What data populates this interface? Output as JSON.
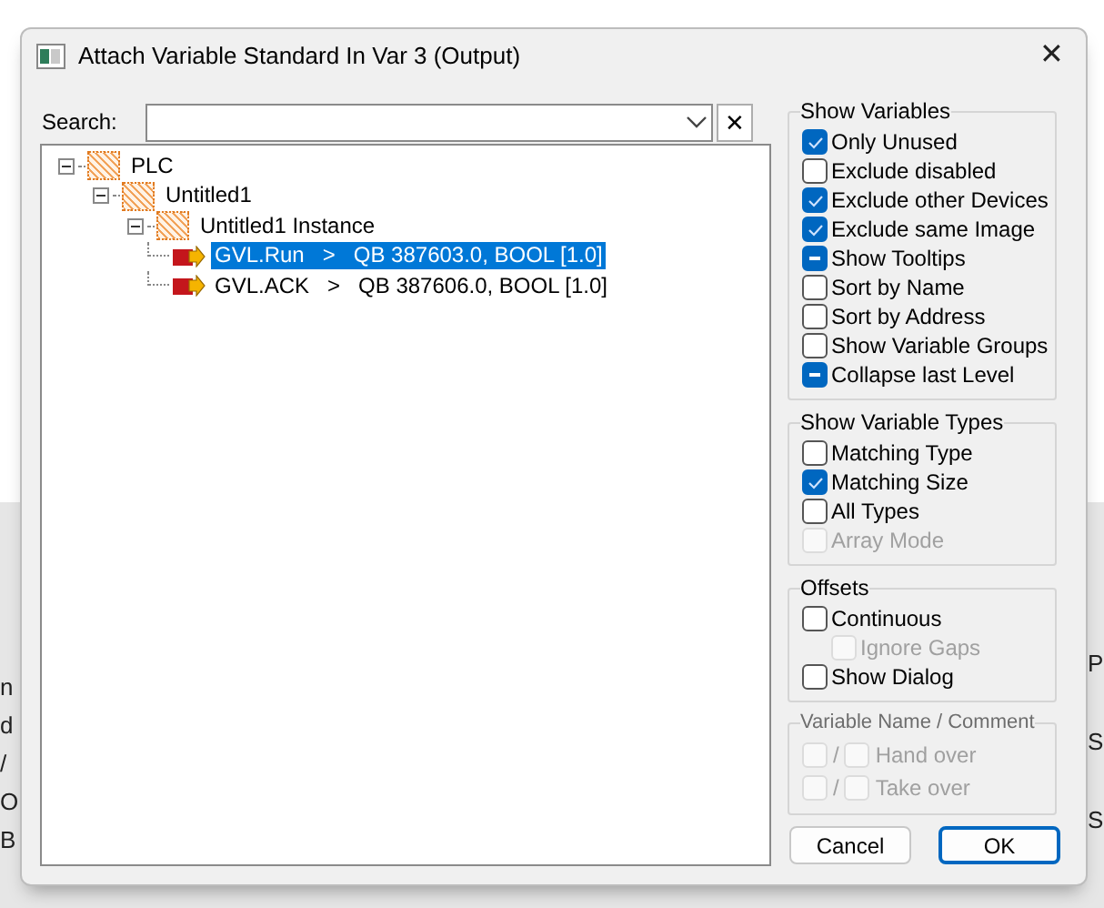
{
  "background": {
    "left_fragments": [
      "n",
      "d",
      "/",
      "O",
      "B"
    ],
    "right_fragments": [
      "P",
      "S",
      "S"
    ]
  },
  "window": {
    "title": "Attach Variable Standard In Var 3 (Output)",
    "close": "✕"
  },
  "search": {
    "label": "Search:",
    "clear": "✕"
  },
  "tree": [
    {
      "kind": "container",
      "label": "PLC",
      "expanded": true,
      "selected": false,
      "children": [
        {
          "kind": "container",
          "label": "Untitled1",
          "expanded": true,
          "selected": false,
          "children": [
            {
              "kind": "container",
              "label": "Untitled1 Instance",
              "expanded": true,
              "selected": false,
              "children": [
                {
                  "kind": "variable",
                  "label": "GVL.Run   >   QB 387603.0, BOOL [1.0]",
                  "selected": true
                },
                {
                  "kind": "variable",
                  "label": "GVL.ACK   >   QB 387606.0, BOOL [1.0]",
                  "selected": false
                }
              ]
            }
          ]
        }
      ]
    }
  ],
  "groups": [
    {
      "title": "Show Variables",
      "disabled": false,
      "options": [
        {
          "label": "Only Unused",
          "checked": true,
          "mixed": false,
          "disabled": false
        },
        {
          "label": "Exclude disabled",
          "checked": false,
          "mixed": false,
          "disabled": false
        },
        {
          "label": "Exclude other Devices",
          "checked": true,
          "mixed": false,
          "disabled": false
        },
        {
          "label": "Exclude same Image",
          "checked": true,
          "mixed": false,
          "disabled": false
        },
        {
          "label": "Show Tooltips",
          "checked": true,
          "mixed": true,
          "disabled": false
        },
        {
          "label": "Sort by Name",
          "checked": false,
          "mixed": false,
          "disabled": false
        },
        {
          "label": "Sort by Address",
          "checked": false,
          "mixed": false,
          "disabled": false
        },
        {
          "label": "Show Variable Groups",
          "checked": false,
          "mixed": false,
          "disabled": false
        },
        {
          "label": "Collapse last Level",
          "checked": true,
          "mixed": true,
          "disabled": false
        }
      ]
    },
    {
      "title": "Show Variable Types",
      "disabled": false,
      "options": [
        {
          "label": "Matching Type",
          "checked": false,
          "mixed": false,
          "disabled": false
        },
        {
          "label": "Matching Size",
          "checked": true,
          "mixed": false,
          "disabled": false
        },
        {
          "label": "All Types",
          "checked": false,
          "mixed": false,
          "disabled": false
        },
        {
          "label": "Array Mode",
          "checked": false,
          "mixed": false,
          "disabled": true
        }
      ]
    },
    {
      "title": "Offsets",
      "disabled": false,
      "options": [
        {
          "label": "Continuous",
          "checked": false,
          "mixed": false,
          "disabled": false,
          "indented": false
        },
        {
          "label": "Ignore Gaps",
          "checked": false,
          "mixed": false,
          "disabled": true,
          "indented": true
        },
        {
          "label": "Show Dialog",
          "checked": false,
          "mixed": false,
          "disabled": false,
          "indented": false
        }
      ]
    },
    {
      "title": "Variable Name / Comment",
      "disabled": true,
      "pairs": [
        {
          "separator": "/",
          "label": "Hand over",
          "first_checked": false,
          "second_checked": false,
          "disabled": true
        },
        {
          "separator": "/",
          "label": "Take over",
          "first_checked": false,
          "second_checked": false,
          "disabled": true
        }
      ]
    }
  ],
  "buttons": [
    {
      "label": "Cancel",
      "default": false
    },
    {
      "label": "OK",
      "default": true
    }
  ]
}
